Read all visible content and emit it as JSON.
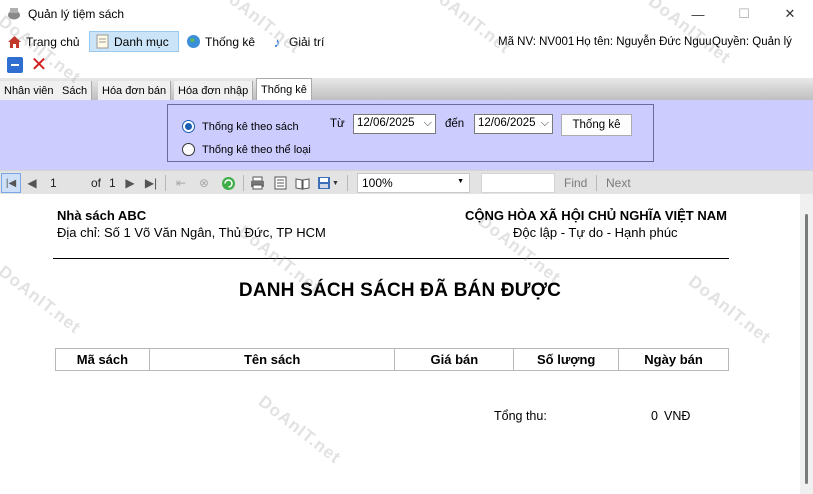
{
  "window": {
    "title": "Quản lý tiệm sách",
    "minimize_glyph": "—",
    "maximize_glyph": "☐",
    "close_glyph": "✕"
  },
  "menu": {
    "items": [
      {
        "label": "Trang chủ",
        "icon": "home-icon"
      },
      {
        "label": "Danh mục",
        "icon": "notepad-icon"
      },
      {
        "label": "Thống kê",
        "icon": "globe-icon"
      },
      {
        "label": "Giải trí",
        "icon": "music-note-icon"
      }
    ],
    "user": {
      "ma_nv": "Mã NV: NV001",
      "ho_ten": "Họ tên: Nguyễn Đức Nguu",
      "quyen": "Quyền: Quản lý"
    }
  },
  "tabs": [
    {
      "label": "Nhân viên"
    },
    {
      "label": "Sách"
    },
    {
      "label": "Hóa đơn bán"
    },
    {
      "label": "Hóa đơn nhập"
    },
    {
      "label": "Thống kê",
      "selected": true
    }
  ],
  "filter": {
    "option_by_book": "Thống kê theo sách",
    "option_by_category": "Thống kê theo thể loại",
    "selected_option": "Thống kê theo sách",
    "from_label": "Từ",
    "from_date": "12/06/2025",
    "to_label": "đến",
    "to_date": "12/06/2025",
    "submit_label": "Thống kê"
  },
  "report_toolbar": {
    "page_current": "1",
    "page_of": "of",
    "page_total": "1",
    "zoom": "100%",
    "find_label": "Find",
    "next_label": "Next"
  },
  "report": {
    "company_name": "Nhà sách ABC",
    "company_address": "Địa chỉ: Số 1 Võ Văn Ngân, Thủ Đức, TP HCM",
    "national_title": "CỘNG HÒA XÃ HỘI CHỦ NGHĨA VIỆT NAM",
    "national_motto": "Độc lập - Tự do - Hạnh phúc",
    "heading": "DANH SÁCH SÁCH ĐÃ BÁN ĐƯỢC",
    "columns": [
      "Mã sách",
      "Tên sách",
      "Giá bán",
      "Số lượng",
      "Ngày bán"
    ],
    "rows": [],
    "total_label": "Tổng thu:",
    "total_value": "0",
    "total_unit": "VNĐ"
  },
  "watermark": "DoAnIT.net"
}
